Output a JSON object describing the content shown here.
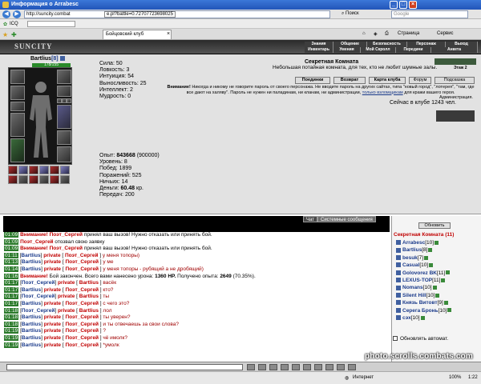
{
  "window": {
    "title": "Информация о Arrabesc",
    "controls": [
      "_",
      "□",
      "×"
    ]
  },
  "browser": {
    "url": "http://suncity.combat",
    "url_tail": "e.pl?battle=0.72707723698025",
    "search_label": "Поиск",
    "search_placeholder": "Google",
    "toolbar": {
      "icq": "ICQ",
      "page_menu": "Страница",
      "service_menu": "Сервис"
    },
    "tab_title": "Бойцовский клуб"
  },
  "game": {
    "logo": "SUNCITY",
    "menu_top": [
      "Знания",
      "Общение",
      "Безопасность",
      "Персонаж",
      "Выход"
    ],
    "menu_bottom": [
      "Инвентарь",
      "Умения",
      "Мой Скролл",
      "Передачи",
      "Анкета"
    ]
  },
  "character": {
    "name": "Bartlius",
    "level": "[8]",
    "hp": "178/155",
    "stats": [
      "Сила: 50",
      "Ловкость: 3",
      "Интуиция: 54",
      "Выносливость: 25",
      "Интеллект: 2",
      "Мудрость: 0"
    ],
    "stats2": [
      {
        "label": "Опыт:",
        "value": "843668",
        "extra": "(900000)"
      },
      {
        "label": "Уровень:",
        "value": "8",
        "extra": ""
      },
      {
        "label": "Побед:",
        "value": "1899",
        "extra": ""
      },
      {
        "label": "Поражений:",
        "value": "525",
        "extra": ""
      },
      {
        "label": "Ничьих:",
        "value": "14",
        "extra": ""
      },
      {
        "label": "Деньги:",
        "value": "60.48",
        "extra": "кр."
      },
      {
        "label": "Передач:",
        "value": "200",
        "extra": ""
      }
    ]
  },
  "room": {
    "title": "Секретная Комната",
    "subtitle": "Небольшая потайная комната, для тех, кто не любит шумные залы.",
    "floor": "Этаж 2",
    "buttons": [
      "Поединки",
      "Возврат",
      "Карта клуба",
      "Форум",
      "Подсказка"
    ],
    "warning_label": "Внимание!",
    "warning": "Никогда и никому не говорите пароль от своего персонажа. Не вводите пароль на других сайтах, типа \"новый город\", \"лотерея\", \"там, где все дают на халяву\". Пароль не нужен ни паладинам, ни кланам, ни администрации,",
    "warning_link": "только взломщикам",
    "warning_end": "для кражи вашего героя.",
    "admin": "Администрация.",
    "online": "Сейчас в клубе 1243 чел."
  },
  "chat": {
    "tabs": [
      "Чат",
      "Системные сообщения"
    ],
    "lines": [
      {
        "time": "01:09",
        "kind": "sys",
        "label": "Внимание!",
        "nick": "Поэт_Сергей",
        "text": "принял ваш вызов! Нужно отказать или принять бой."
      },
      {
        "time": "01:09",
        "kind": "plain",
        "nick": "Поэт_Сергей",
        "text": "отозвал свою заявку"
      },
      {
        "time": "01:09",
        "kind": "sys",
        "label": "Внимание!",
        "nick": "Поэт_Сергей",
        "text": "принял ваш вызов! Нужно отказать или принять бой."
      },
      {
        "time": "01:11",
        "kind": "prv",
        "from": "Bartlius",
        "to": "Поэт_Сергей",
        "text": "у меня топоры)"
      },
      {
        "time": "01:13",
        "kind": "prv",
        "from": "Bartlius",
        "to": "Поэт_Сергей",
        "text": "у ме"
      },
      {
        "time": "01:14",
        "kind": "prv",
        "from": "Bartlius",
        "to": "Поэт_Сергей",
        "text": "у меня топоры - рубящий а не дробящий)"
      },
      {
        "time": "01:16",
        "kind": "end",
        "label": "Внимание!",
        "text": "Бой закончен. Всего вами нанесено урона:",
        "dmg": "1360 HP.",
        "exp_label": "Получено опыта:",
        "exp": "2649",
        "pct": "(70.35%)."
      },
      {
        "time": "01:17",
        "kind": "prv",
        "from": "Поэт_Сергей",
        "to": "Bartlius",
        "text": "васёк"
      },
      {
        "time": "01:17",
        "kind": "prv",
        "from": "Bartlius",
        "to": "Поэт_Сергей",
        "text": "кто?"
      },
      {
        "time": "01:17",
        "kind": "prv",
        "from": "Поэт_Сергей",
        "to": "Bartlius",
        "text": "ты"
      },
      {
        "time": "01:17",
        "kind": "prv",
        "from": "Bartlius",
        "to": "Поэт_Сергей",
        "text": "с чего это?"
      },
      {
        "time": "01:18",
        "kind": "prv",
        "from": "Поэт_Сергей",
        "to": "Bartlius",
        "text": "лол"
      },
      {
        "time": "01:18",
        "kind": "prv",
        "from": "Bartlius",
        "to": "Поэт_Сергей",
        "text": "ты уверен?"
      },
      {
        "time": "01:18",
        "kind": "prv",
        "from": "Bartlius",
        "to": "Поэт_Сергей",
        "text": "и ты отвечаешь за свои слова?"
      },
      {
        "time": "01:19",
        "kind": "prv",
        "from": "Bartlius",
        "to": "Поэт_Сергей",
        "text": "?"
      },
      {
        "time": "01:19",
        "kind": "prv",
        "from": "Bartlius",
        "to": "Поэт_Сергей",
        "text": "чё имолк?"
      },
      {
        "time": "01:19",
        "kind": "prv",
        "from": "Bartlius",
        "to": "Поэт_Сергей",
        "text": "*умолк"
      }
    ],
    "private_word": "private"
  },
  "userlist": {
    "refresh": "Обновить",
    "room_header": "Секретная Комната (11)",
    "users": [
      {
        "name": "Arrabesc",
        "level": "[10]"
      },
      {
        "name": "Bartlius",
        "level": "[8]"
      },
      {
        "name": "besuk",
        "level": "[7]"
      },
      {
        "name": "Casual",
        "level": "[10]"
      },
      {
        "name": "Golovorez BK",
        "level": "[11]"
      },
      {
        "name": "LEXUS-TOP",
        "level": "[11]"
      },
      {
        "name": "Nomans",
        "level": "[10]"
      },
      {
        "name": "Silent Hill",
        "level": "[10]"
      },
      {
        "name": "Князь Витовт",
        "level": "[9]"
      },
      {
        "name": "Серега Бронь",
        "level": "[10]"
      },
      {
        "name": "сэх",
        "level": "[10]"
      }
    ],
    "auto_refresh": "Обновлять автомат."
  },
  "statusbar": {
    "internet": "Интернет",
    "zoom": "100%",
    "clock": "1:22"
  },
  "watermark": "photo.scrolls.combats.com"
}
